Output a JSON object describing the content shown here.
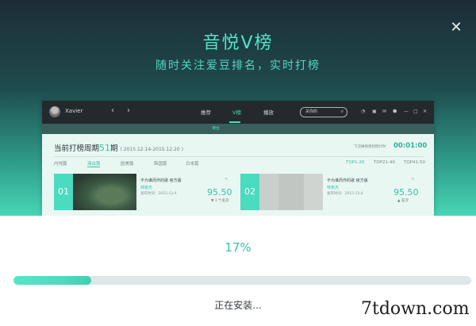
{
  "installer": {
    "title": "音悦V榜",
    "subtitle": "随时关注爱豆排名，实时打榜",
    "progress_percent_label": "17%",
    "progress_fraction": 0.17,
    "status": "正在安装...",
    "close_icon": "close-icon"
  },
  "app": {
    "username": "Xavier",
    "nav": [
      "推荐",
      "V榜",
      "播放"
    ],
    "search_placeholder": "关你的",
    "subtab": "港台",
    "period": {
      "label": "当前打榜周期",
      "number": "51",
      "unit": "期",
      "dates": "( 2015.12.14-2015.12.20 )"
    },
    "hint": "下次换榜更新倒计时",
    "countdown": "00:01:00",
    "regions": [
      "内地篇",
      "港台篇",
      "欧美篇",
      "韩国篇",
      "日本篇"
    ],
    "ranges": [
      "TOP1-20",
      "TOP21-40",
      "TOP41-50"
    ],
    "cards": [
      {
        "rank": "01",
        "song": "不为谁而作的歌 官方版",
        "artist": "林俊杰",
        "date": "发布时间：2015-12-4",
        "score": "95.50",
        "trend": "▼ 1 个名次"
      },
      {
        "rank": "02",
        "song": "不为谁而作的歌 官方版",
        "artist": "林俊杰",
        "date": "发布时间：2015-12-4",
        "score": "95.50",
        "trend": "▲ 名次"
      }
    ]
  },
  "watermark": "7tdown.com",
  "colors": {
    "accent": "#37c3a4",
    "track": "#dee6e9"
  }
}
